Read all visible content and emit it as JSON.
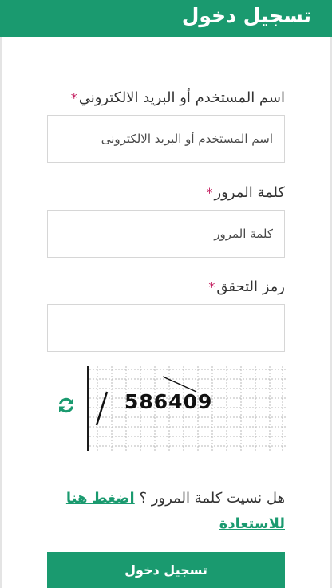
{
  "header": {
    "title": "تسجيل دخول"
  },
  "form": {
    "username": {
      "label": "اسم المستخدم أو البريد الالكتروني",
      "required_mark": "*",
      "placeholder": "اسم المستخدم أو البريد الالكترونى",
      "value": ""
    },
    "password": {
      "label": "كلمة المرور",
      "required_mark": "*",
      "placeholder": "كلمة المرور",
      "value": ""
    },
    "captcha": {
      "label": "رمز التحقق",
      "required_mark": "*",
      "value": "",
      "image_code": "586409",
      "refresh_icon": "refresh-arrows-icon"
    },
    "forgot": {
      "question": "هل نسيت كلمة المرور ؟",
      "link_part1": "اضغط هنا",
      "link_part2": "للاستعادة"
    },
    "submit_label": "تسجيل دخول"
  },
  "colors": {
    "brand": "#1a9a6f",
    "required": "#c2185b",
    "border": "#d6d6d6",
    "text": "#333333"
  }
}
